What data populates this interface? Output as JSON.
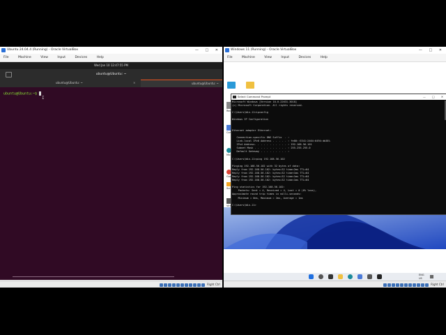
{
  "left_window": {
    "title": "Ubuntu 24.04.4 (Running) - Oracle VirtualBox",
    "menu": [
      "File",
      "Machine",
      "View",
      "Input",
      "Devices",
      "Help"
    ],
    "topbar_clock": "Wed Jan 10  12:47:55 PM",
    "terminal_title": "ubuntu@Ubuntu: ~",
    "tabs": [
      "ubuntu@Ubuntu: ~",
      "ubuntu@Ubuntu: ~"
    ],
    "prompt": "ubuntu@Ubuntu:~$ ",
    "host_key": "Right Ctrl"
  },
  "right_window": {
    "title": "Windows 11 (Running) - Oracle VirtualBox",
    "menu": [
      "File",
      "Machine",
      "View",
      "Input",
      "Devices",
      "Help"
    ],
    "cmd_title": "Select Command Prompt",
    "cmd_lines": [
      "Microsoft Windows [Version 10.0.22631.3018]",
      "(c) Microsoft Corporation. All rights reserved.",
      "",
      "C:\\Users\\Win-11>ipconfig",
      "",
      "Windows IP Configuration",
      "",
      "",
      "Ethernet adapter Ethernet:",
      "",
      "   Connection-specific DNS Suffix  . :",
      "   Link-local IPv6 Address . . . . . : fe80::5341:2464:6494:db38%",
      "   IPv4 Address. . . . . . . . . . . : 192.168.56.101",
      "   Subnet Mask . . . . . . . . . . . : 255.255.255.0",
      "   Default Gateway . . . . . . . . . :",
      "",
      "C:\\Users\\Win-11>ping 192.168.56.102",
      "",
      "Pinging 192.168.56.102 with 32 bytes of data:",
      "Reply from 192.168.56.102: bytes=32 time=2ms TTL=64",
      "Reply from 192.168.56.102: bytes=32 time<1ms TTL=64",
      "Reply from 192.168.56.102: bytes=32 time=1ms TTL=64",
      "Reply from 192.168.56.102: bytes=32 time=1ms TTL=64",
      "",
      "Ping statistics for 192.168.56.102:",
      "    Packets: Sent = 4, Received = 4, Lost = 0 (0% loss),",
      "Approximate round trip times in milli-seconds:",
      "    Minimum = 0ms, Maximum = 2ms, Average = 1ms",
      "",
      "C:\\Users\\Win-11>"
    ],
    "desktop_icons": [
      "Recycle Bin",
      "Control Panel",
      "Microsoft Edge",
      "Google Chrome",
      "Scratch",
      "VirtualBox"
    ],
    "tray_lang": "ENG",
    "tray_region": "US",
    "host_key": "Right Ctrl"
  },
  "colors": {
    "ubuntu_terminal": "#300a24",
    "ubuntu_prompt": "#8ae234",
    "cmd_bg": "#0c0c0c",
    "win_wallpaper": "#1a3fb8"
  }
}
